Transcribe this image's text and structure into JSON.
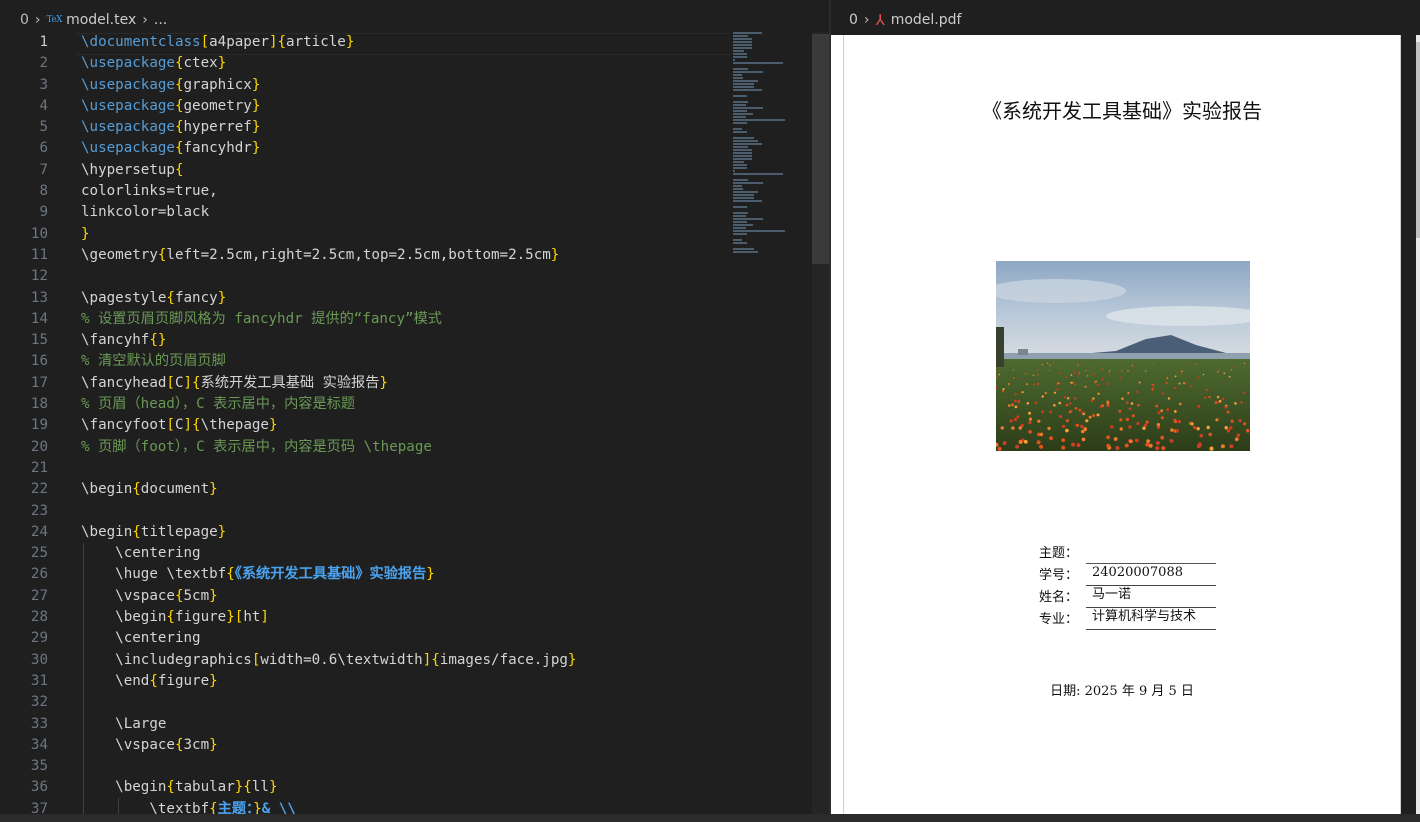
{
  "editor": {
    "breadcrumb": {
      "num": "0",
      "file": "model.tex",
      "ellipsis": "..."
    },
    "lines": [
      {
        "n": "1",
        "html": "<span class=\"k\">\\documentclass</span><span class=\"b\">[</span>a4paper<span class=\"b\">]{</span>article<span class=\"b\">}</span>"
      },
      {
        "n": "2",
        "html": "<span class=\"k\">\\usepackage</span><span class=\"b\">{</span>ctex<span class=\"b\">}</span>"
      },
      {
        "n": "3",
        "html": "<span class=\"k\">\\usepackage</span><span class=\"b\">{</span>graphicx<span class=\"b\">}</span>"
      },
      {
        "n": "4",
        "html": "<span class=\"k\">\\usepackage</span><span class=\"b\">{</span>geometry<span class=\"b\">}</span>"
      },
      {
        "n": "5",
        "html": "<span class=\"k\">\\usepackage</span><span class=\"b\">{</span>hyperref<span class=\"b\">}</span>"
      },
      {
        "n": "6",
        "html": "<span class=\"k\">\\usepackage</span><span class=\"b\">{</span>fancyhdr<span class=\"b\">}</span>"
      },
      {
        "n": "7",
        "html": "\\hypersetup<span class=\"b\">{</span>"
      },
      {
        "n": "8",
        "html": "colorlinks=true,"
      },
      {
        "n": "9",
        "html": "linkcolor=black"
      },
      {
        "n": "10",
        "html": "<span class=\"b\">}</span>"
      },
      {
        "n": "11",
        "html": "\\geometry<span class=\"b\">{</span>left=2.5cm,right=2.5cm,top=2.5cm,bottom=2.5cm<span class=\"b\">}</span>"
      },
      {
        "n": "12",
        "html": ""
      },
      {
        "n": "13",
        "html": "\\pagestyle<span class=\"b\">{</span>fancy<span class=\"b\">}</span>"
      },
      {
        "n": "14",
        "html": "<span class=\"c\">% 设置页眉页脚风格为 fancyhdr 提供的“fancy”模式</span>"
      },
      {
        "n": "15",
        "html": "\\fancyhf<span class=\"b\">{}</span>"
      },
      {
        "n": "16",
        "html": "<span class=\"c\">% 清空默认的页眉页脚</span>"
      },
      {
        "n": "17",
        "html": "\\fancyhead<span class=\"b\">[</span>C<span class=\"b\">]{</span>系统开发工具基础 实验报告<span class=\"b\">}</span>"
      },
      {
        "n": "18",
        "html": "<span class=\"c\">% 页眉（head），C 表示居中，内容是标题</span>"
      },
      {
        "n": "19",
        "html": "\\fancyfoot<span class=\"b\">[</span>C<span class=\"b\">]{</span>\\thepage<span class=\"b\">}</span>"
      },
      {
        "n": "20",
        "html": "<span class=\"c\">% 页脚（foot），C 表示居中，内容是页码 \\thepage</span>"
      },
      {
        "n": "21",
        "html": ""
      },
      {
        "n": "22",
        "html": "\\begin<span class=\"b\">{</span>document<span class=\"b\">}</span>"
      },
      {
        "n": "23",
        "html": ""
      },
      {
        "n": "24",
        "html": "\\begin<span class=\"b\">{</span>titlepage<span class=\"b\">}</span>"
      },
      {
        "n": "25",
        "html": "    \\centering"
      },
      {
        "n": "26",
        "html": "    \\huge \\textbf<span class=\"b\">{</span><span class=\"s\">《系统开发工具基础》实验报告</span><span class=\"b\">}</span>"
      },
      {
        "n": "27",
        "html": "    \\vspace<span class=\"b\">{</span>5cm<span class=\"b\">}</span>"
      },
      {
        "n": "28",
        "html": "    \\begin<span class=\"b\">{</span>figure<span class=\"b\">}[</span>ht<span class=\"b\">]</span>"
      },
      {
        "n": "29",
        "html": "    \\centering"
      },
      {
        "n": "30",
        "html": "    \\includegraphics<span class=\"b\">[</span>width=0.6\\textwidth<span class=\"b\">]{</span>images/face.jpg<span class=\"b\">}</span>"
      },
      {
        "n": "31",
        "html": "    \\end<span class=\"b\">{</span>figure<span class=\"b\">}</span>"
      },
      {
        "n": "32",
        "html": ""
      },
      {
        "n": "33",
        "html": "    \\Large"
      },
      {
        "n": "34",
        "html": "    \\vspace<span class=\"b\">{</span>3cm<span class=\"b\">}</span>"
      },
      {
        "n": "35",
        "html": ""
      },
      {
        "n": "36",
        "html": "    \\begin<span class=\"b\">{</span>tabular<span class=\"b\">}{</span>ll<span class=\"b\">}</span>"
      },
      {
        "n": "37",
        "html": "        \\textbf<span class=\"b\">{</span><span class=\"s\">主题：</span><span class=\"b\">}</span><span class=\"s\">&amp; \\\\</span>"
      }
    ]
  },
  "pdf": {
    "breadcrumb": {
      "num": "0",
      "file": "model.pdf"
    },
    "title": "《系统开发工具基础》实验报告",
    "table": [
      {
        "label": "主题：",
        "value": ""
      },
      {
        "label": "学号：",
        "value": "24020007088"
      },
      {
        "label": "姓名：",
        "value": "马一诺"
      },
      {
        "label": "专业：",
        "value": "计算机科学与技术"
      }
    ],
    "date": "日期: 2025 年 9 月 5 日"
  },
  "icons": {
    "tex": "TeX",
    "pdf": "pdf-icon",
    "chevron": "chevron-right-icon"
  }
}
